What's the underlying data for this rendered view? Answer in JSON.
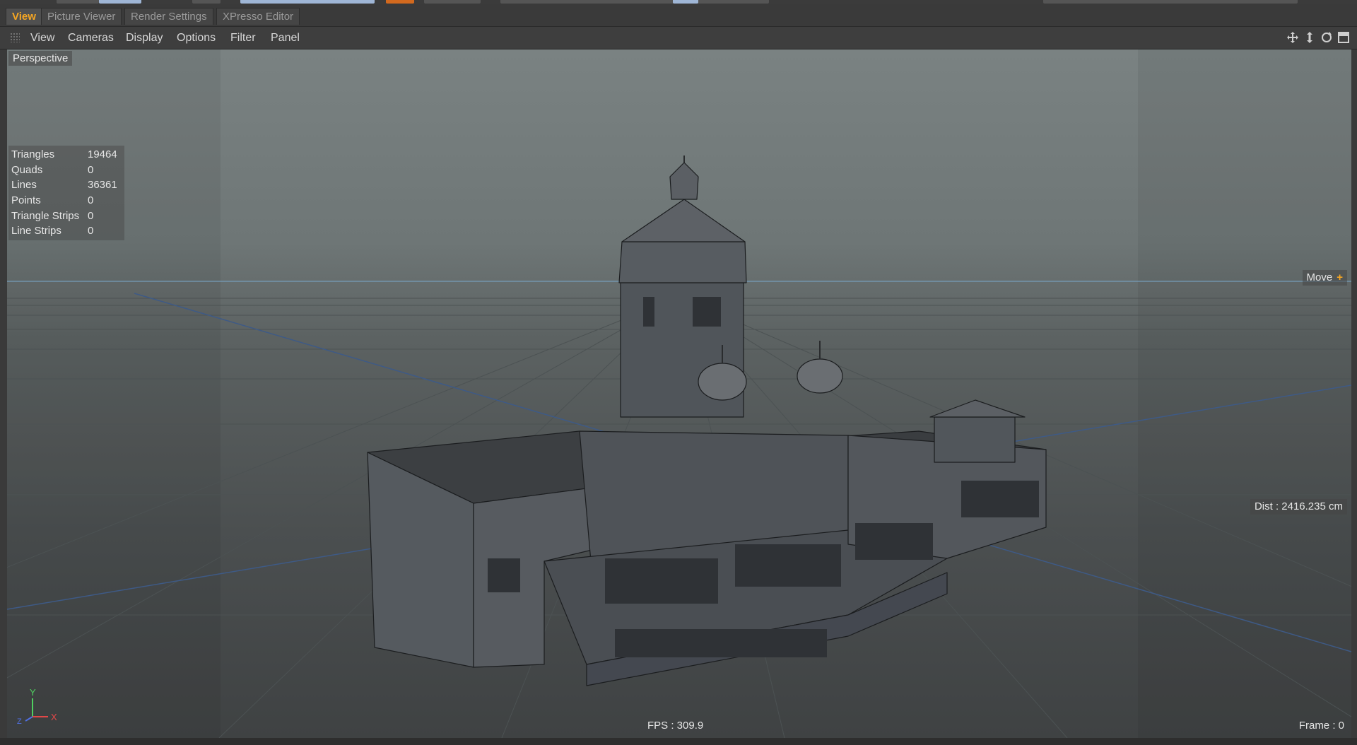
{
  "tabs": [
    {
      "label": "View",
      "active": true
    },
    {
      "label": "Picture Viewer",
      "active": false
    },
    {
      "label": "Render Settings",
      "active": false
    },
    {
      "label": "XPresso Editor",
      "active": false
    }
  ],
  "menu": [
    "View",
    "Cameras",
    "Display",
    "Options",
    "Filter",
    "Panel"
  ],
  "nav_icons": [
    "move-view-icon",
    "zoom-view-icon",
    "rotate-view-icon",
    "toggle-layout-icon"
  ],
  "viewport": {
    "camera_label": "Perspective",
    "stats": [
      {
        "label": "Triangles",
        "value": "19464"
      },
      {
        "label": "Quads",
        "value": "0"
      },
      {
        "label": "Lines",
        "value": "36361"
      },
      {
        "label": "Points",
        "value": "0"
      },
      {
        "label": "Triangle Strips",
        "value": "0"
      },
      {
        "label": "Line Strips",
        "value": "0"
      }
    ],
    "tool": "Move",
    "distance": "Dist : 2416.235 cm",
    "fps": "FPS : 309.9",
    "frame": "Frame : 0",
    "axis": {
      "y": "Y",
      "x": "X",
      "z": "Z"
    }
  },
  "colors": {
    "accent": "#f5a623",
    "axis_x": "#e04848",
    "axis_y": "#4fcf60",
    "axis_z": "#4f6fe0",
    "horizon": "#7aa8cc"
  }
}
